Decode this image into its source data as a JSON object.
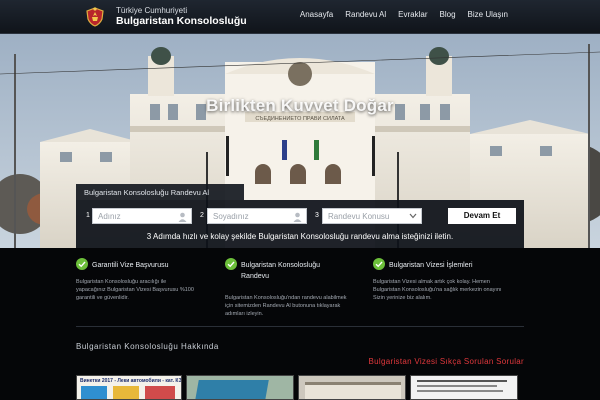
{
  "header": {
    "brand_small": "Türkiye Cumhuriyeti",
    "brand_big": "Bulgaristan Konsolosluğu",
    "logo_icon": "coat-of-arms-icon",
    "nav": [
      {
        "label": "Anasayfa"
      },
      {
        "label": "Randevu Al"
      },
      {
        "label": "Evraklar"
      },
      {
        "label": "Blog"
      },
      {
        "label": "Bize Ulaşın"
      }
    ]
  },
  "hero": {
    "tagline": "Birlikten Kuvvet Doğar",
    "building_inscription": "СЪЕДИНЕНИЕТО ПРАВИ СИЛАТА"
  },
  "form": {
    "tab_label": "Bulgaristan Konsolosluğu Randevu Al",
    "fields": [
      {
        "number": "1",
        "placeholder": "Adınız"
      },
      {
        "number": "2",
        "placeholder": "Soyadınız"
      },
      {
        "number": "3",
        "placeholder": "Randevu Konusu"
      }
    ],
    "submit_label": "Devam Et",
    "note": "3 Adımda hızlı ve kolay şekilde Bulgaristan Konsolosluğu randevu alma isteğinizi iletin."
  },
  "features": [
    {
      "title": "Garantili Vize Başvurusu",
      "lines": [
        "Bulgaristan Konsolosluğu aracılığı ile",
        "yapacağınız Bulgaristan Vizesi Başvurusu %100",
        "garantili ve güvenlidir."
      ]
    },
    {
      "title": "Bulgaristan Konsolosluğu Randevu",
      "lines": [
        "Bulgaristan Konsolosluğu'ndan randevu alabilmek",
        "için sitemizden Randevu Al butonuna tıklayarak",
        "adımları izleyin."
      ]
    },
    {
      "title": "Bulgaristan Vizesi İşlemleri",
      "lines": [
        "Bulgaristan Vizesi almak artık çok kolay. Hemen",
        "Bulgaristan Konsolosluğu'na sağlık merkezin onayını",
        "Sizin yerinize biz alalım."
      ]
    }
  ],
  "about_title": "Bulgaristan Konsolosluğu Hakkında",
  "faq_title": "Bulgaristan Vizesi Sıkça Sorulan Sorular",
  "thumbnails": [
    {
      "caption": "Винетки 2017 - Леки автомобили - кат. КЗ"
    },
    {
      "caption": ""
    },
    {
      "caption": ""
    },
    {
      "caption": ""
    }
  ],
  "colors": {
    "accent_green": "#6cbf3a",
    "faq_red": "#e0383c",
    "panel_bg": "#0c1018"
  }
}
